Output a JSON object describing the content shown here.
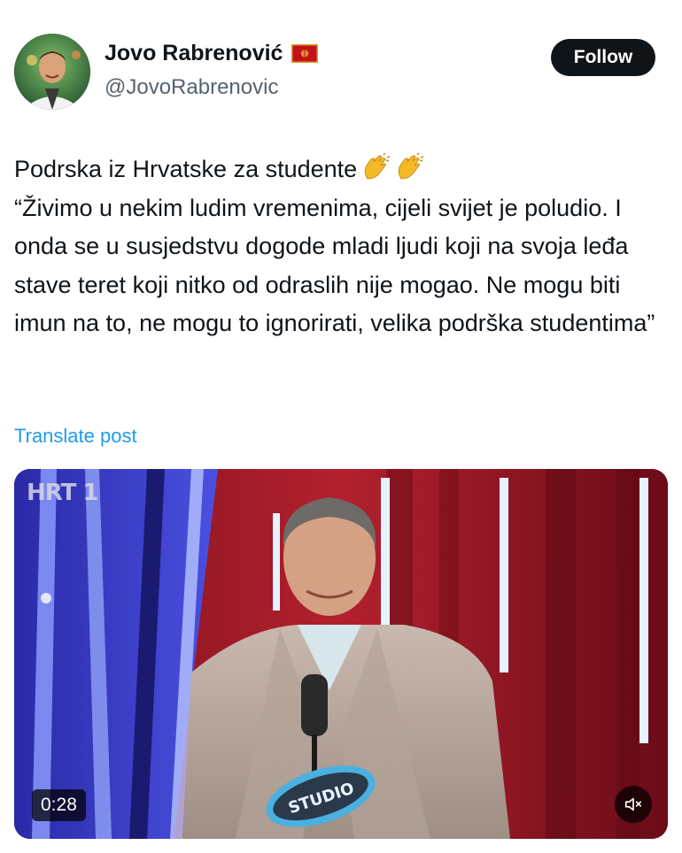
{
  "author": {
    "display_name": "Jovo Rabrenović",
    "handle": "@JovoRabrenovic",
    "flag_icon": "montenegro-flag-icon",
    "avatar_icon": "avatar-icon"
  },
  "follow_button": {
    "label": "Follow"
  },
  "tweet": {
    "line1": "Podrska iz Hrvatske za studente",
    "emoji": "clapping-hands-icon",
    "quote": "“Živimo u nekim ludim vremenima, cijeli svijet je poludio. I onda se u susjedstvu dogode mladi ljudi koji na svoja leđa stave teret koji nitko od odraslih nije mogao. Ne mogu biti imun na to, ne mogu to ignorirati, velika podrška studentima”"
  },
  "translate_link": "Translate post",
  "video": {
    "channel_logo": "HRT 1",
    "duration": "0:28",
    "mute_icon": "mute-icon",
    "podium_text": "STUDIO"
  },
  "colors": {
    "link": "#1d9bf0",
    "text": "#0f1419",
    "secondary": "#536471",
    "button_bg": "#0f1419"
  }
}
